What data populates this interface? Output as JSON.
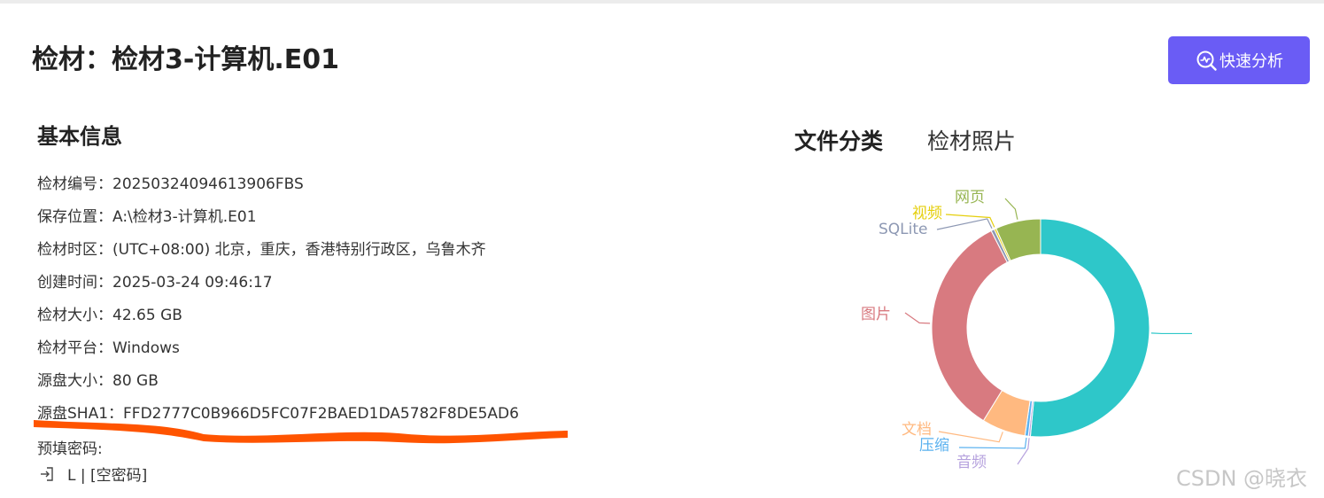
{
  "header": {
    "title": "检材：检材3-计算机.E01",
    "quick_analysis_label": "快速分析"
  },
  "basic_info": {
    "title": "基本信息",
    "rows": [
      {
        "label": "检材编号：",
        "value": "20250324094613906FBS"
      },
      {
        "label": "保存位置：",
        "value": "A:\\检材3-计算机.E01"
      },
      {
        "label": "检材时区：",
        "value": "(UTC+08:00) 北京，重庆，香港特别行政区，乌鲁木齐"
      },
      {
        "label": "创建时间：",
        "value": "2025-03-24 09:46:17"
      },
      {
        "label": "检材大小：",
        "value": "42.65 GB"
      },
      {
        "label": "检材平台：",
        "value": "Windows"
      },
      {
        "label": "源盘大小：",
        "value": "80 GB"
      },
      {
        "label": "源盘SHA1：",
        "value": "FFD2777C0B966D5FC07F2BAED1DA5782F8DE5AD6"
      }
    ],
    "password_label": "预填密码:",
    "password_item": "L | [空密码]",
    "password_icon": "login-arrow-icon"
  },
  "tabs": [
    {
      "label": "文件分类",
      "active": true
    },
    {
      "label": "检材照片",
      "active": false
    }
  ],
  "chart_data": {
    "type": "pie",
    "donut": true,
    "categories": [
      "",
      "音频",
      "压缩",
      "文档",
      "图片",
      "SQLite",
      "视频",
      "网页"
    ],
    "values": [
      51.5,
      0.3,
      0.5,
      6.5,
      33.7,
      0.5,
      0.3,
      6.7
    ],
    "colors": [
      "#2ec7c9",
      "#b6a2de",
      "#5ab1ef",
      "#ffb980",
      "#d87a80",
      "#8d98b3",
      "#e5cf0d",
      "#97b552"
    ]
  },
  "watermark": "CSDN @晓衣"
}
